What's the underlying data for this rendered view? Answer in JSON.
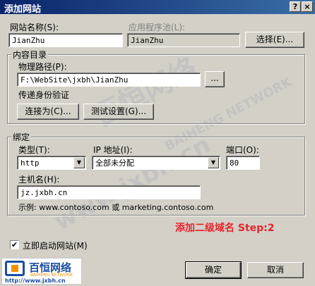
{
  "window": {
    "title": "添加网站",
    "help_glyph": "?",
    "close_glyph": "×"
  },
  "site_name": {
    "label": "网站名称(S):",
    "value": "JianZhu"
  },
  "app_pool": {
    "label": "应用程序池(L):",
    "value": "JianZhu",
    "select_button": "选择(E)..."
  },
  "content_dir": {
    "legend": "内容目录",
    "physical_path_label": "物理路径(P):",
    "physical_path_value": "F:\\WebSite\\jxbh\\JianZhu",
    "browse_button": "...",
    "pass_through_label": "传递身份验证",
    "connect_as_button": "连接为(C)...",
    "test_settings_button": "测试设置(G)..."
  },
  "binding": {
    "legend": "绑定",
    "type_label": "类型(T):",
    "type_value": "http",
    "ip_label": "IP 地址(I):",
    "ip_value": "全部未分配",
    "port_label": "端口(O):",
    "port_value": "80",
    "host_label": "主机名(H):",
    "host_value": "jz.jxbh.cn",
    "example_text": "示例: www.contoso.com 或 marketing.contoso.com"
  },
  "annotation": "添加二级域名 Step:2",
  "start_now": {
    "label": "立即启动网站(M)",
    "checked": true,
    "check_glyph": "✔"
  },
  "buttons": {
    "ok": "确定",
    "cancel": "取消"
  },
  "logo": {
    "name": "百恒网络",
    "subtitle": "BAIHENG NETWORK",
    "url": "http://www.jxbh.cn"
  },
  "watermark": {
    "brand": "百恒网络",
    "url": "www.jxbh.cn",
    "subtitle": "BAIHENG NETWORK"
  },
  "colors": {
    "title_bar": "#0a246a",
    "dialog_bg": "#d4d0c8",
    "annotation": "#e8232a",
    "logo_blue": "#1a4fa0",
    "logo_orange": "#f29400"
  }
}
